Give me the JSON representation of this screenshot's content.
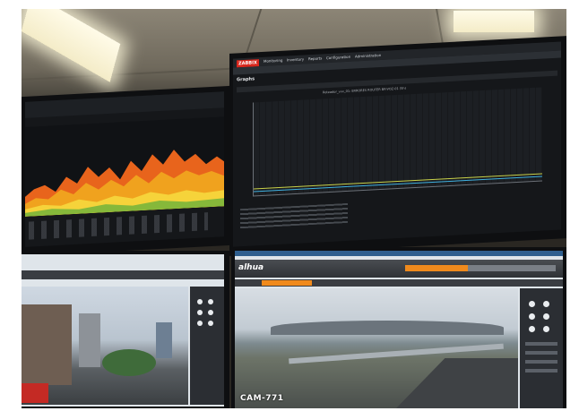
{
  "zabbix": {
    "logo": "ZABBIX",
    "menu": [
      "Monitoring",
      "Inventory",
      "Reports",
      "Configuration",
      "Administration"
    ],
    "page_title": "Graphs",
    "graph_title": "Roteador_vvv_01: ERRORES ROUTER BR-VOZ-01 (5h)"
  },
  "dahua": {
    "logo": "alhua",
    "camera_label": "CAM-771"
  }
}
